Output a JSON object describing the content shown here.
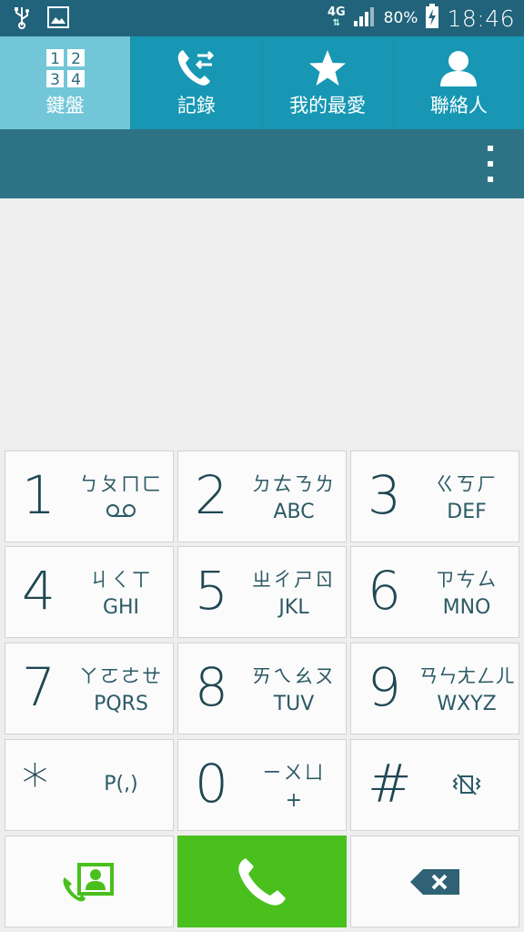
{
  "status_bar": {
    "network": "4G",
    "battery_percent": "80%",
    "time": "18:46",
    "icons": [
      "usb-icon",
      "image-icon",
      "signal-icon",
      "battery-charging-icon"
    ]
  },
  "tabs": [
    {
      "label": "鍵盤",
      "icon": "keypad-icon",
      "active": true
    },
    {
      "label": "記錄",
      "icon": "call-log-icon",
      "active": false
    },
    {
      "label": "我的最愛",
      "icon": "star-icon",
      "active": false
    },
    {
      "label": "聯絡人",
      "icon": "contact-icon",
      "active": false
    }
  ],
  "colors": {
    "status_bar": "#21637a",
    "tab_bg": "#1797b4",
    "tab_active": "#72c6d8",
    "toolbar": "#2e7385",
    "call_green": "#49c01d",
    "key_text": "#1f4752"
  },
  "keypad": {
    "keys": [
      {
        "digit": "1",
        "top": "ㄅㄆㄇㄈ",
        "bottom": ""
      },
      {
        "digit": "2",
        "top": "ㄉㄊㄋㄌ",
        "bottom": "ABC"
      },
      {
        "digit": "3",
        "top": "ㄍㄎㄏ",
        "bottom": "DEF"
      },
      {
        "digit": "4",
        "top": "ㄐㄑㄒ",
        "bottom": "GHI"
      },
      {
        "digit": "5",
        "top": "ㄓㄔㄕㄖ",
        "bottom": "JKL"
      },
      {
        "digit": "6",
        "top": "ㄗㄘㄙ",
        "bottom": "MNO"
      },
      {
        "digit": "7",
        "top": "ㄚㄛㄜㄝ",
        "bottom": "PQRS"
      },
      {
        "digit": "8",
        "top": "ㄞㄟㄠㄡ",
        "bottom": "TUV"
      },
      {
        "digit": "9",
        "top": "ㄢㄣㄤㄥㄦ",
        "bottom": "WXYZ"
      },
      {
        "digit": "*",
        "top": "",
        "bottom": "P(,)"
      },
      {
        "digit": "0",
        "top": "ㄧㄨㄩ",
        "bottom": "+"
      },
      {
        "digit": "#",
        "top": "",
        "bottom": ""
      }
    ]
  }
}
